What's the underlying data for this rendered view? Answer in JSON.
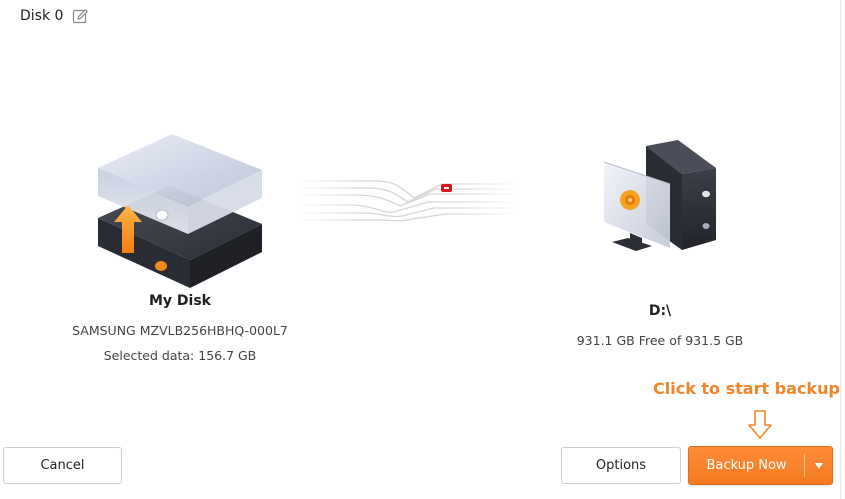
{
  "task": {
    "title": "Disk 0"
  },
  "source": {
    "name": "My Disk",
    "model": "SAMSUNG MZVLB256HBHQ-000L7",
    "selected_data": "Selected data: 156.7 GB"
  },
  "destination": {
    "name": "D:\\",
    "free_space": "931.1 GB Free of 931.5 GB"
  },
  "hint": {
    "text": "Click to start backup"
  },
  "buttons": {
    "cancel": "Cancel",
    "options": "Options",
    "backup_now": "Backup Now"
  },
  "colors": {
    "accent": "#f47a1f",
    "hint": "#f0862a",
    "flow_indicator": "#d9141e"
  },
  "icons": {
    "edit": "edit-icon",
    "source": "disk-backup-icon",
    "flow": "data-flow-icon",
    "destination": "computer-icon",
    "hint_arrow": "arrow-down-icon",
    "dropdown": "caret-down-icon"
  }
}
